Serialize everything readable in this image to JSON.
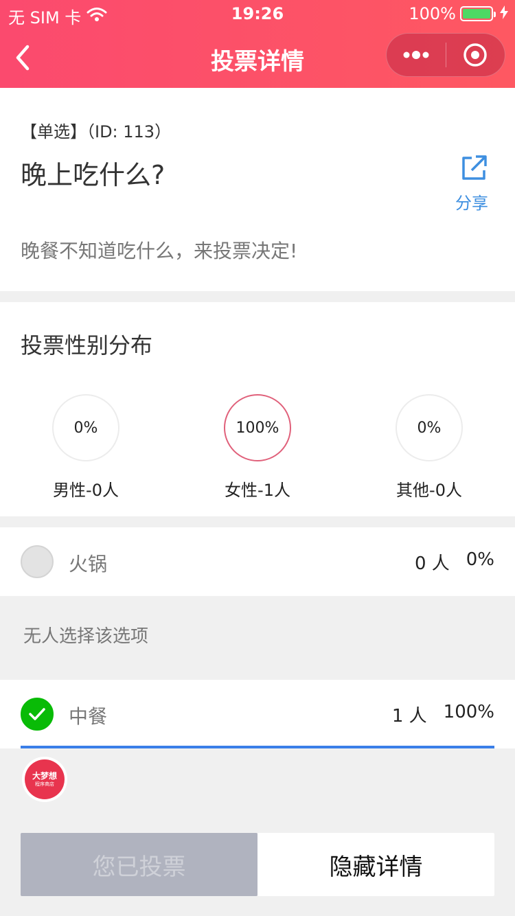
{
  "status_bar": {
    "carrier": "无 SIM 卡",
    "time": "19:26",
    "battery": "100%"
  },
  "nav": {
    "title": "投票详情"
  },
  "vote": {
    "type_label": "【单选】（ID: 113）",
    "title": "晚上吃什么?",
    "share_label": "分享",
    "description": "晚餐不知道吃什么，来投票决定!"
  },
  "gender": {
    "title": "投票性别分布",
    "items": [
      {
        "percent": "0%",
        "label": "男性-0人",
        "active": false
      },
      {
        "percent": "100%",
        "label": "女性-1人",
        "active": true
      },
      {
        "percent": "0%",
        "label": "其他-0人",
        "active": false
      }
    ]
  },
  "options": [
    {
      "name": "火锅",
      "count": "0 人",
      "percent": "0%",
      "selected": false,
      "progress": 0
    },
    {
      "name": "中餐",
      "count": "1 人",
      "percent": "100%",
      "selected": true,
      "progress": 1.0
    }
  ],
  "empty_option_text": "无人选择该选项",
  "logo": {
    "line1": "大梦想",
    "line2": "程序商店"
  },
  "buttons": {
    "voted": "您已投票",
    "hide": "隐藏详情"
  },
  "colors": {
    "header_start": "#fb4a6e",
    "header_end": "#fe5862",
    "share_blue": "#3e8fe0",
    "check_green": "#09bb07",
    "progress_blue": "#3a7fe8"
  }
}
